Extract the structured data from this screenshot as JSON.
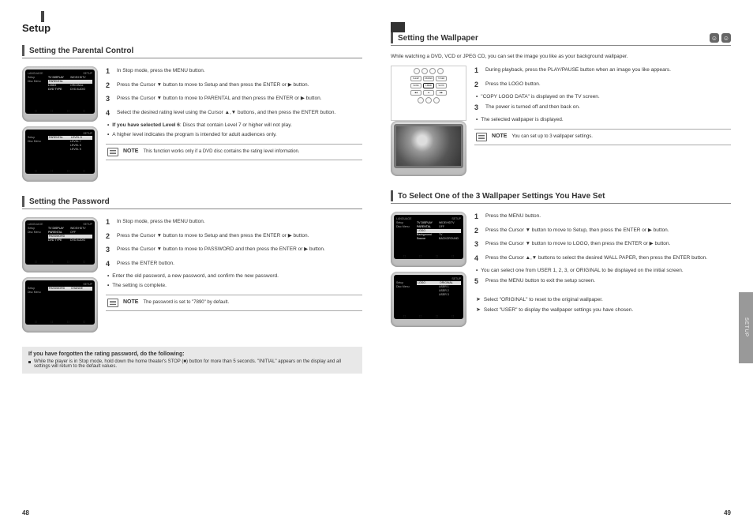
{
  "pageLeft": {
    "number": "48",
    "mainTitle": "Setup",
    "sec1": {
      "title": "Setting the Parental Control",
      "step1": "In Stop mode, press the MENU button.",
      "step2": "Press the Cursor ▼ button to move to Setup and then press the ENTER or ▶ button.",
      "step3": "Press the Cursor ▼ button to move to PARENTAL and then press the ENTER or ▶ button.",
      "step4": "Select the desired rating level using the Cursor ▲,▼ buttons, and then press the ENTER button.",
      "bullet1_label": "If you have selected Level 6",
      "bullet1_text": "Discs that contain Level 7 or higher will not play.",
      "bullet2_text": "A higher level indicates the program is intended for adult audiences only.",
      "note1": {
        "label": "NOTE",
        "text": "This function works only if a DVD disc contains the rating level information."
      },
      "menu1": {
        "lang": "LANGUAGE",
        "tvd": "TV DISPLAY",
        "tvd_v": "WIDE/HDTV",
        "par": "PARENTAL",
        "par_v": "",
        "logo": "LOGO",
        "logo_v": "ORIGINAL",
        "dvd": "DVD TYPE",
        "dvd_v": "DVD AUDIO"
      },
      "menu2": {
        "par": "PARENTAL",
        "lv": [
          "LEVEL 8",
          "LEVEL 7",
          "LEVEL 6",
          "LEVEL 5"
        ]
      }
    },
    "sec2": {
      "title": "Setting the Password",
      "step1": "In Stop mode, press the MENU button.",
      "step2": "Press the Cursor ▼ button to move to Setup and then press the ENTER or ▶ button.",
      "step3": "Press the Cursor ▼ button to move to PASSWORD and then press the ENTER or ▶ button.",
      "step4": "Press the ENTER button.",
      "bullet1": "Enter the old password, a new password, and confirm the new password.",
      "bullet2": "The setting is complete.",
      "note1": {
        "label": "NOTE",
        "text": "The password is set to \"7890\" by default."
      },
      "box": {
        "title": "If you have forgotten the rating password, do the following:",
        "b1": "While the player is in Stop mode, hold down the home theater's STOP (■) button for more than 5 seconds. \"INITIAL\" appears on the display and all settings will return to the default values."
      },
      "menu1": {
        "lang": "LANGUAGE",
        "tvd": "TV DISPLAY",
        "tvd_v": "WIDE/HDTV",
        "par": "PARENTAL",
        "par_v": "OFF",
        "pwd": "PASSWORD",
        "pwd_v": "",
        "dvd": "DVD TYPE",
        "dvd_v": "DVD AUDIO"
      },
      "menu2": {
        "pwd": "PASSWORD",
        "chg": "CHANGE"
      }
    }
  },
  "pageRight": {
    "number": "49",
    "sideTab": "SETUP",
    "sec1": {
      "title": "Setting the Wallpaper",
      "icons": [
        "JPEG",
        "DVD"
      ],
      "intro": "While watching a DVD, VCD or JPEG CD, you can set the image you like as your background wallpaper.",
      "step1": "During playback, press the PLAY/PAUSE button when an image you like appears.",
      "step2": "Press the LOGO button.",
      "b1": "\"COPY LOGO DATA\" is displayed on the TV screen.",
      "step3": "The power is turned off and then back on.",
      "b2": "The selected wallpaper is displayed.",
      "note1": {
        "label": "NOTE",
        "text": "You can set up to 3 wallpaper settings."
      },
      "remote": {
        "hl": "LOGO"
      }
    },
    "sec2": {
      "title": "To Select One of the 3 Wallpaper Settings You Have Set",
      "step1": "Press the MENU button.",
      "step2": "Press the Cursor ▼ button to move to Setup, then press the ENTER or ▶ button.",
      "step3": "Press the Cursor ▼ button to move to LOGO, then press the ENTER or ▶ button.",
      "step4": "Press the Cursor ▲,▼ buttons to select the desired WALL PAPER, then press the ENTER button.",
      "b1": "You can select one from USER 1, 2, 3, or ORIGINAL to be displayed on the initial screen.",
      "step5": "Press the MENU button to exit the setup screen.",
      "ch1": "Select \"ORIGINAL\" to reset to the original wallpaper.",
      "ch2": "Select \"USER\" to display the wallpaper settings you have chosen.",
      "menu1": {
        "lang": "LANGUAGE",
        "tvd": "TV DISPLAY",
        "tvd_v": "WIDE/HDTV",
        "par": "PARENTAL",
        "par_v": "OFF",
        "logo": "LOGO",
        "logo_v": "",
        "bgs": "Background Source",
        "bgs_v": "TV BACKGROUND"
      },
      "menu2": {
        "logo": "LOGO",
        "opts": [
          "ORIGINAL",
          "USER 1",
          "USER 2",
          "USER 3"
        ]
      }
    }
  }
}
